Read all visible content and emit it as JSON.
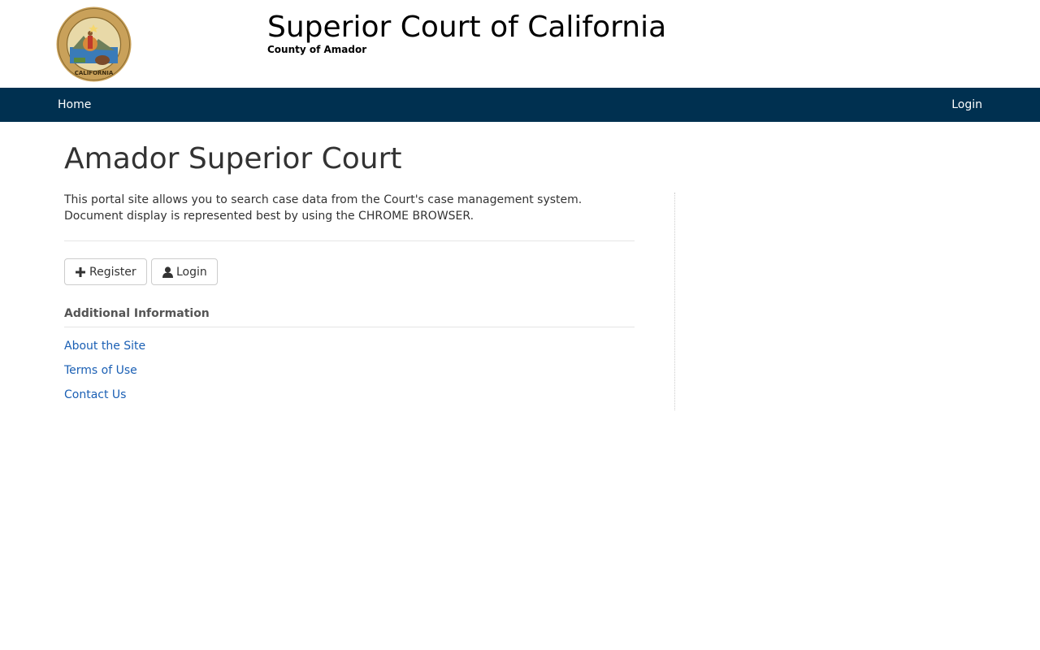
{
  "header": {
    "title": "Superior Court of California",
    "subtitle": "County of Amador",
    "seal_icon": "california-state-seal"
  },
  "nav": {
    "home_label": "Home",
    "login_label": "Login",
    "background_color": "#003050"
  },
  "main": {
    "title": "Amador Superior Court",
    "intro_line1": "This portal site allows you to search case data from the Court's case management system.",
    "intro_line2": "Document display is represented best by using the CHROME BROWSER.",
    "buttons": {
      "register_label": "Register",
      "register_icon": "plus-icon",
      "login_label": "Login",
      "login_icon": "user-icon"
    },
    "additional_info": {
      "heading": "Additional Information",
      "links": [
        {
          "label": "About the Site"
        },
        {
          "label": "Terms of Use"
        },
        {
          "label": "Contact Us"
        }
      ]
    }
  },
  "colors": {
    "link": "#1a5fb4",
    "text": "#333333"
  }
}
